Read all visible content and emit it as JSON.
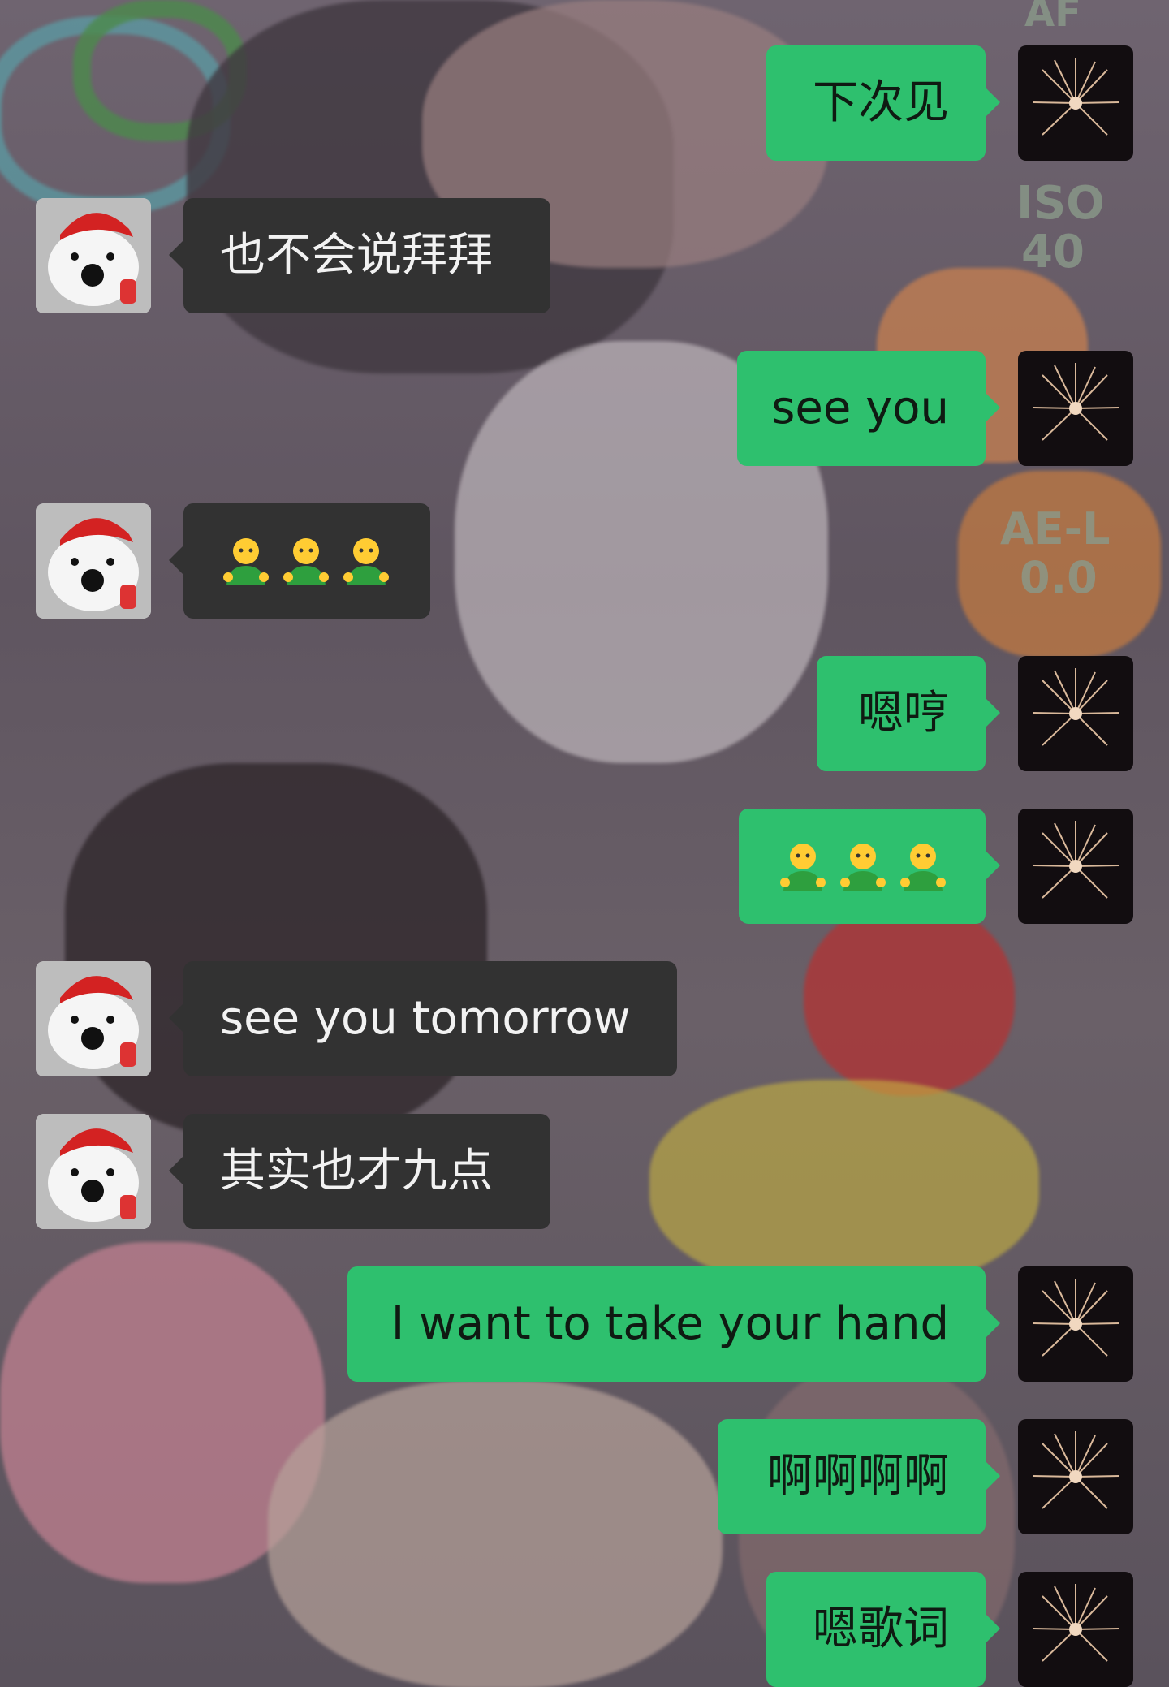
{
  "chat": {
    "messages": [
      {
        "side": "right",
        "text": "下次见"
      },
      {
        "side": "left",
        "text": "也不会说拜拜"
      },
      {
        "side": "right",
        "text": "see you"
      },
      {
        "side": "left",
        "emoji": [
          "person-hugging-emoji",
          "person-hugging-emoji",
          "person-hugging-emoji"
        ]
      },
      {
        "side": "right",
        "text": "嗯哼"
      },
      {
        "side": "right",
        "emoji": [
          "person-hugging-emoji",
          "person-hugging-emoji",
          "person-hugging-emoji"
        ]
      },
      {
        "side": "left",
        "text": "see you tomorrow"
      },
      {
        "side": "left",
        "text": "其实也才九点"
      },
      {
        "side": "right",
        "text": "I want to take your hand"
      },
      {
        "side": "right",
        "text": "啊啊啊啊"
      },
      {
        "side": "right",
        "text": "嗯歌词"
      }
    ]
  },
  "wallpaper_overlay": {
    "af": "AF",
    "iso_label": "ISO",
    "iso_value": "40",
    "ael_label": "AE-L",
    "ael_value": "0.0"
  },
  "avatars": {
    "left": "dog-santa-hat-avatar",
    "right": "fireworks-avatar"
  },
  "colors": {
    "right_bubble": "#2ec06e",
    "left_bubble": "#323232",
    "left_text": "#f2f2f2",
    "right_text": "#0f1a12"
  }
}
